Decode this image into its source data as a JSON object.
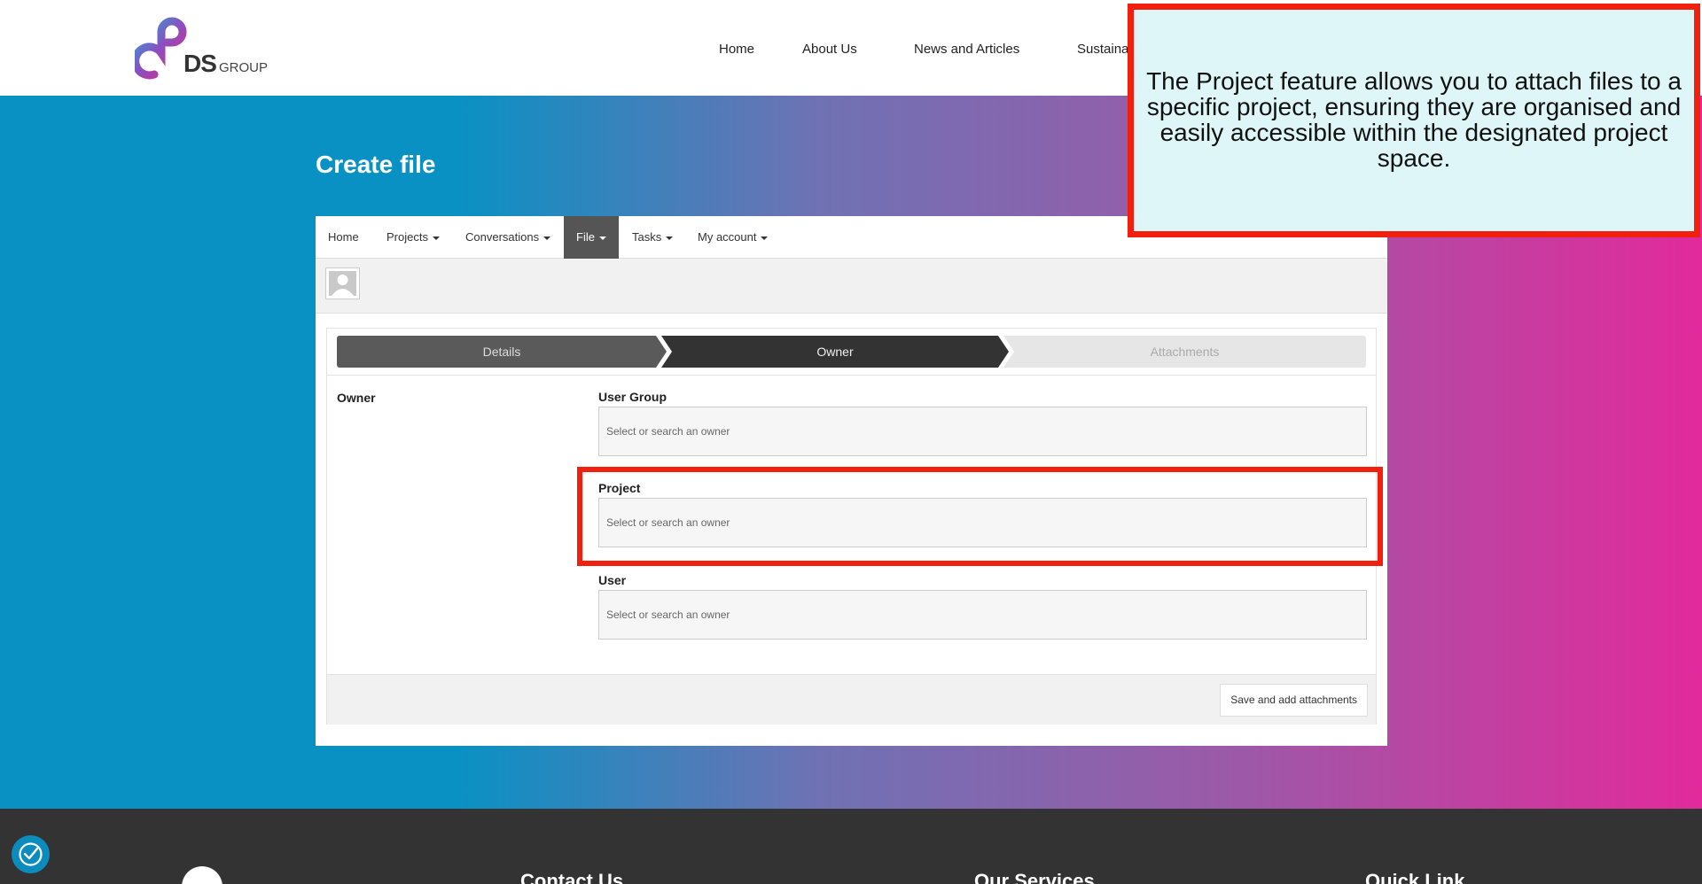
{
  "site": {
    "logo_text": "DS",
    "logo_sub": "GROUP",
    "nav": [
      "Home",
      "About Us",
      "News and Articles",
      "Sustaina"
    ]
  },
  "page": {
    "title": "Create file"
  },
  "app_nav": {
    "items": [
      "Home",
      "Projects",
      "Conversations",
      "File",
      "Tasks",
      "My account"
    ]
  },
  "steps": {
    "details": "Details",
    "owner": "Owner",
    "attachments": "Attachments"
  },
  "form": {
    "section_label": "Owner",
    "fields": [
      {
        "label": "User Group",
        "placeholder": "Select or search an owner"
      },
      {
        "label": "Project",
        "placeholder": "Select or search an owner"
      },
      {
        "label": "User",
        "placeholder": "Select or search an owner"
      }
    ],
    "save_label": "Save and add attachments"
  },
  "callout": {
    "text": "The Project feature allows you to attach files to a specific project, ensuring they are organised and easily accessible within the designated project space."
  },
  "footer": {
    "headings": [
      "Contact Us",
      "Our Services",
      "Quick Link"
    ]
  },
  "colors": {
    "highlight": "#f01f0e",
    "callout_bg": "#def6f7",
    "footer_bg": "#333333"
  }
}
